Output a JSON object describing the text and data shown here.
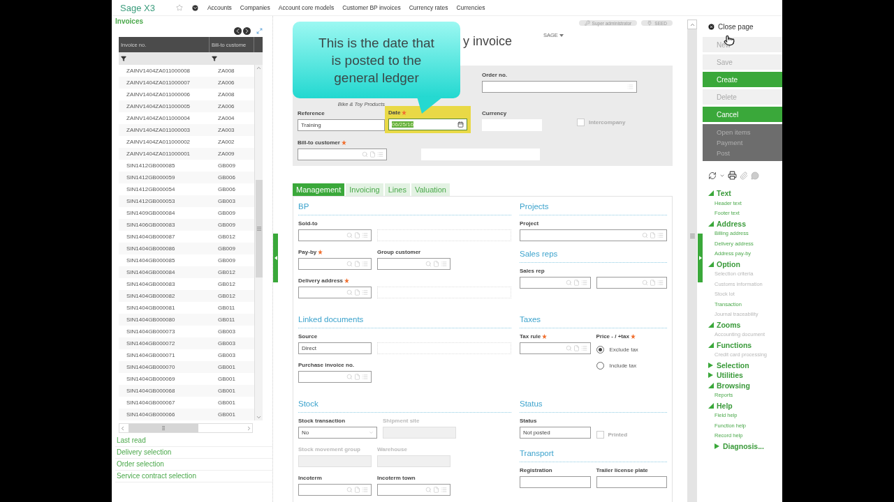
{
  "top_bar": {
    "logo": "Sage X3",
    "links": [
      "Accounts",
      "Companies",
      "Account core models",
      "Customer BP invoices",
      "Currency rates",
      "Currencies"
    ]
  },
  "list_panel": {
    "title": "Invoices",
    "columns": [
      "Invoice no.",
      "Bill-to custome"
    ],
    "rows": [
      [
        "ZAINV1404ZA011000008",
        "ZA008"
      ],
      [
        "ZAINV1404ZA011000007",
        "ZA006"
      ],
      [
        "ZAINV1404ZA011000006",
        "ZA008"
      ],
      [
        "ZAINV1404ZA011000005",
        "ZA006"
      ],
      [
        "ZAINV1404ZA011000004",
        "ZA004"
      ],
      [
        "ZAINV1404ZA011000003",
        "ZA003"
      ],
      [
        "ZAINV1404ZA011000002",
        "ZA002"
      ],
      [
        "ZAINV1404ZA011000001",
        "ZA009"
      ],
      [
        "SIN1412GB000085",
        "GB009"
      ],
      [
        "SIN1412GB000059",
        "GB006"
      ],
      [
        "SIN1412GB000054",
        "GB006"
      ],
      [
        "SIN1412GB000053",
        "GB003"
      ],
      [
        "SIN1409GB000084",
        "GB009"
      ],
      [
        "SIN1406GB000083",
        "GB009"
      ],
      [
        "SIN1404GB000087",
        "GB012"
      ],
      [
        "SIN1404GB000086",
        "GB009"
      ],
      [
        "SIN1404GB000085",
        "GB009"
      ],
      [
        "SIN1404GB000084",
        "GB012"
      ],
      [
        "SIN1404GB000083",
        "GB012"
      ],
      [
        "SIN1404GB000082",
        "GB012"
      ],
      [
        "SIN1404GB000081",
        "GB011"
      ],
      [
        "SIN1404GB000080",
        "GB011"
      ],
      [
        "SIN1404GB000073",
        "GB003"
      ],
      [
        "SIN1404GB000072",
        "GB003"
      ],
      [
        "SIN1404GB000071",
        "GB003"
      ],
      [
        "SIN1404GB000070",
        "GB001"
      ],
      [
        "SIN1404GB000069",
        "GB001"
      ],
      [
        "SIN1404GB000068",
        "GB001"
      ],
      [
        "SIN1404GB000067",
        "GB001"
      ],
      [
        "SIN1404GB000066",
        "GB001"
      ]
    ],
    "links": [
      "Last read",
      "Delivery selection",
      "Order selection",
      "Service contract selection"
    ]
  },
  "page": {
    "user": "Super administrator",
    "folder": "SEED",
    "title": "y invoice",
    "site": "SAGE",
    "callout": "This is the date that is posted to the general ledger",
    "header": {
      "order_no": {
        "label": "Order no."
      },
      "company_name": "Bike & Toy Products",
      "reference": {
        "label": "Reference",
        "value": "Training"
      },
      "date": {
        "label": "Date",
        "required": true,
        "value": "06/25/16",
        "highlighted": true,
        "text_selected": true
      },
      "currency": {
        "label": "Currency"
      },
      "intercompany": {
        "label": "Intercompany",
        "checked": false,
        "disabled": true
      },
      "bill_to": {
        "label": "Bill-to customer",
        "required": true
      }
    },
    "tabs": [
      {
        "label": "Management",
        "selected": true
      },
      {
        "label": "Invoicing",
        "selected": false
      },
      {
        "label": "Lines",
        "selected": false
      },
      {
        "label": "Valuation",
        "selected": false
      }
    ],
    "section_rows": [
      {
        "left": [
          {
            "title": "BP",
            "rows": [
              [
                {
                  "kind": "lookup",
                  "label": "Sold-to",
                  "required": false,
                  "disabled": false
                },
                {
                  "kind": "description"
                }
              ],
              [
                {
                  "kind": "lookup",
                  "label": "Pay-by",
                  "required": true,
                  "disabled": false
                },
                {
                  "kind": "lookup",
                  "label": "Group customer",
                  "required": false,
                  "disabled": false
                }
              ],
              [
                {
                  "kind": "lookup",
                  "label": "Delivery address",
                  "required": true,
                  "disabled": false
                },
                {
                  "kind": "description"
                }
              ]
            ]
          }
        ],
        "right": [
          {
            "title": "Projects",
            "rows": [
              [
                {
                  "kind": "lookup",
                  "label": "Project",
                  "required": false,
                  "disabled": false
                }
              ]
            ]
          },
          {
            "title": "Sales reps",
            "rows": [
              [
                {
                  "kind": "lookup",
                  "label": "Sales rep",
                  "required": false,
                  "disabled": false
                },
                {
                  "kind": "lookup"
                }
              ]
            ]
          }
        ]
      },
      {
        "left": [
          {
            "title": "Linked documents",
            "rows": [
              [
                {
                  "kind": "text",
                  "label": "Source",
                  "value": "Direct",
                  "required": false,
                  "disabled": false
                },
                {
                  "kind": "description"
                }
              ],
              [
                {
                  "kind": "lookup",
                  "label": "Purchase invoice no.",
                  "required": false,
                  "disabled": false
                }
              ]
            ]
          }
        ],
        "right": [
          {
            "title": "Taxes",
            "rows": [
              [
                {
                  "kind": "lookup",
                  "label": "Tax rule",
                  "required": true,
                  "disabled": false
                },
                {
                  "kind": "radio_group",
                  "label": "Price - / +tax",
                  "required": true,
                  "options": [
                    {
                      "label": "Exclude tax",
                      "selected": true
                    },
                    {
                      "label": "Include tax",
                      "selected": false
                    }
                  ]
                }
              ]
            ]
          }
        ]
      },
      {
        "left": [
          {
            "title": "Stock",
            "rows": [
              [
                {
                  "kind": "select",
                  "label": "Stock transaction",
                  "value": "No",
                  "required": false,
                  "disabled": false
                },
                {
                  "kind": "text",
                  "label": "Shipment site",
                  "required": false,
                  "disabled": true
                }
              ],
              [
                {
                  "kind": "text",
                  "label": "Stock movement group",
                  "required": false,
                  "disabled": true
                },
                {
                  "kind": "text",
                  "label": "Warehouse",
                  "required": false,
                  "disabled": true
                }
              ],
              [
                {
                  "kind": "lookup",
                  "label": "Incoterm",
                  "required": false,
                  "disabled": false
                },
                {
                  "kind": "lookup",
                  "label": "Incoterm town",
                  "required": false,
                  "disabled": false
                }
              ]
            ]
          }
        ],
        "right": [
          {
            "title": "Status",
            "rows": [
              [
                {
                  "kind": "text",
                  "label": "Status",
                  "value": "Not posted",
                  "required": false,
                  "disabled": false
                },
                {
                  "kind": "checkbox",
                  "label": "Printed",
                  "checked": false,
                  "disabled": true
                }
              ]
            ]
          },
          {
            "title": "Transport",
            "rows": [
              [
                {
                  "kind": "text",
                  "label": "Registration",
                  "required": false,
                  "disabled": false
                },
                {
                  "kind": "text",
                  "label": "Trailer license plate",
                  "required": false,
                  "disabled": false
                }
              ]
            ]
          }
        ]
      }
    ]
  },
  "action_panel": {
    "close": "Close page",
    "buttons": [
      {
        "label": "New",
        "disabled": true
      },
      {
        "label": "Save",
        "disabled": true
      },
      {
        "label": "Create",
        "disabled": false
      },
      {
        "label": "Delete",
        "disabled": true
      },
      {
        "label": "Cancel",
        "disabled": false
      }
    ],
    "more_actions": [
      "Open items",
      "Payment",
      "Post"
    ],
    "tree": [
      {
        "label": "Text",
        "expanded": true,
        "children": [
          {
            "label": "Header text",
            "disabled": false
          },
          {
            "label": "Footer text",
            "disabled": false
          }
        ]
      },
      {
        "label": "Address",
        "expanded": true,
        "children": [
          {
            "label": "Billing address",
            "disabled": false
          },
          {
            "label": "Delivery address",
            "disabled": false
          },
          {
            "label": "Address pay-by",
            "disabled": false
          }
        ]
      },
      {
        "label": "Option",
        "expanded": true,
        "children": [
          {
            "label": "Selection criteria",
            "disabled": true
          },
          {
            "label": "Customs information",
            "disabled": true
          },
          {
            "label": "Stock lot",
            "disabled": true
          },
          {
            "label": "Transaction",
            "disabled": false
          },
          {
            "label": "Journal traceability",
            "disabled": true
          }
        ]
      },
      {
        "label": "Zooms",
        "expanded": true,
        "children": [
          {
            "label": "Accounting document",
            "disabled": true
          }
        ]
      },
      {
        "label": "Functions",
        "expanded": true,
        "children": [
          {
            "label": "Credit card processing",
            "disabled": true
          }
        ]
      },
      {
        "label": "Selection",
        "expanded": false
      },
      {
        "label": "Utilities",
        "expanded": false
      },
      {
        "label": "Browsing",
        "expanded": true,
        "children": [
          {
            "label": "Reports",
            "disabled": false
          }
        ]
      },
      {
        "label": "Help",
        "expanded": true,
        "children": [
          {
            "label": "Field help",
            "disabled": false
          },
          {
            "label": "Function help",
            "disabled": false
          },
          {
            "label": "Record help",
            "disabled": false
          },
          {
            "label": "Diagnosis...",
            "expanded": false
          }
        ]
      }
    ]
  }
}
